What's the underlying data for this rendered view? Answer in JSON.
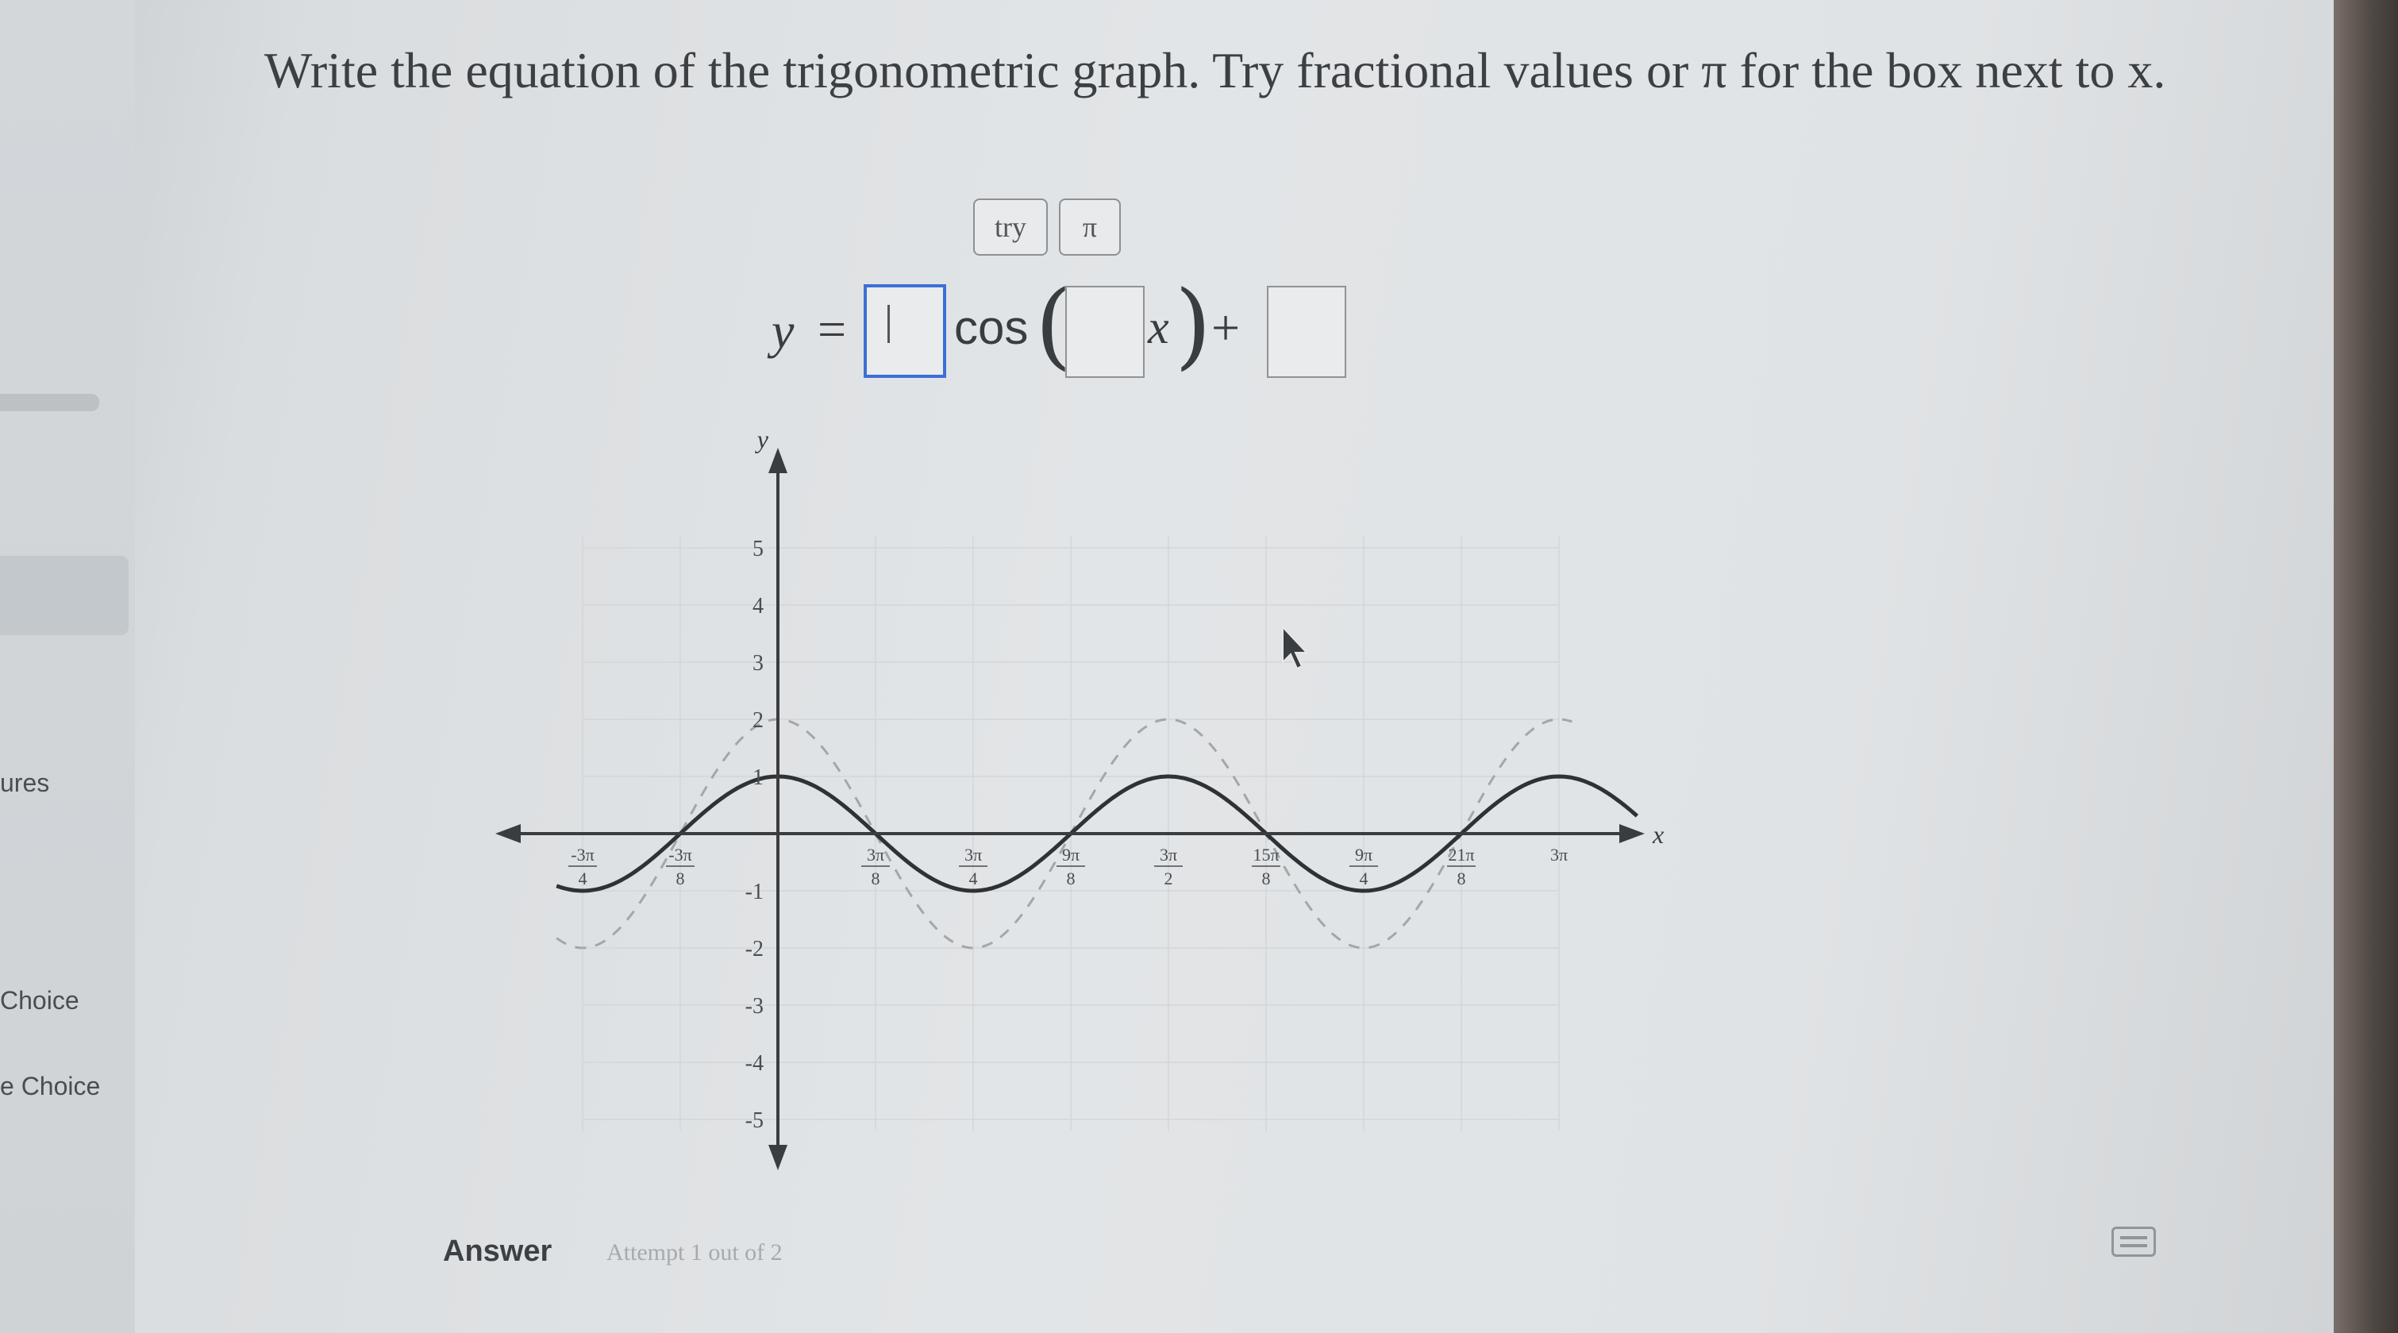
{
  "sidebar": {
    "items": [
      {
        "label": "ures"
      },
      {
        "label": "Choice"
      },
      {
        "label": "e Choice"
      }
    ]
  },
  "question": {
    "text": "Write the equation of the trigonometric graph. Try fractional values or π for the box next to x."
  },
  "toolbar": {
    "try_label": "try",
    "pi_label": "π"
  },
  "equation": {
    "lhs": "y",
    "equals": "=",
    "func": "cos",
    "var": "x",
    "plus": "+"
  },
  "graph": {
    "y_axis_label": "y",
    "x_axis_label": "x",
    "y_ticks": [
      {
        "label": "5",
        "v": 5
      },
      {
        "label": "4",
        "v": 4
      },
      {
        "label": "3",
        "v": 3
      },
      {
        "label": "2",
        "v": 2
      },
      {
        "label": "1",
        "v": 1
      },
      {
        "label": "-1",
        "v": -1
      },
      {
        "label": "-2",
        "v": -2
      },
      {
        "label": "-3",
        "v": -3
      },
      {
        "label": "-4",
        "v": -4
      },
      {
        "label": "-5",
        "v": -5
      }
    ],
    "x_ticks": [
      {
        "num": "-3π",
        "den": "4",
        "k": -6
      },
      {
        "num": "-3π",
        "den": "8",
        "k": -3
      },
      {
        "num": "3π",
        "den": "8",
        "k": 3
      },
      {
        "num": "3π",
        "den": "4",
        "k": 6
      },
      {
        "num": "9π",
        "den": "8",
        "k": 9
      },
      {
        "num": "3π",
        "den": "2",
        "k": 12
      },
      {
        "num": "15π",
        "den": "8",
        "k": 15
      },
      {
        "num": "9π",
        "den": "4",
        "k": 18
      },
      {
        "num": "21π",
        "den": "8",
        "k": 21
      },
      {
        "num": "3π",
        "den": "",
        "k": 24
      }
    ],
    "curve": {
      "amplitude": 1,
      "period_pi": 1.5,
      "shift": 0,
      "x_min_pi": -0.85,
      "x_max_pi": 3.3
    },
    "ghost_curve": {
      "amplitude": 2,
      "period_pi": 1.5,
      "shift": 0,
      "x_min_pi": -0.85,
      "x_max_pi": 3.05
    },
    "colors": {
      "curve": "#2f3235",
      "ghost": "#a3a7aa",
      "axis": "#3a3d40",
      "grid": "#d3d6d8"
    }
  },
  "answer": {
    "label": "Answer",
    "attempt": "Attempt 1 out of 2"
  }
}
